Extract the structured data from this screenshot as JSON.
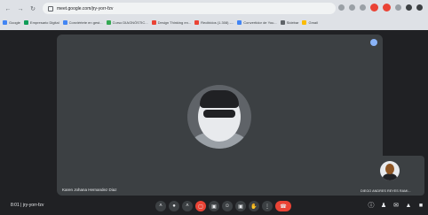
{
  "browser": {
    "url": "meet.google.com/jry-yorr-fzv",
    "bookmarks": [
      {
        "label": "Google",
        "color": "#4285f4"
      },
      {
        "label": "Empresario Digital",
        "color": "#0f9d58"
      },
      {
        "label": "Conviértete en gest...",
        "color": "#4285f4"
      },
      {
        "label": "Curso DIAGNÓSTIC...",
        "color": "#34a853"
      },
      {
        "label": "Design Thinking en...",
        "color": "#ea4335"
      },
      {
        "label": "Recibidos (1.308) -...",
        "color": "#ea4335"
      },
      {
        "label": "Convertidor de You...",
        "color": "#4285f4"
      },
      {
        "label": "Sidebar",
        "color": "#5f6368"
      },
      {
        "label": "Gmail",
        "color": "#fbbc05"
      }
    ]
  },
  "meeting": {
    "main_participant": "Karen Johana Hernandez Diaz",
    "self_participant": "DIEGO ANDRES REYES RAMI...",
    "time": "8:01",
    "meeting_code": "jry-yorr-fzv"
  },
  "colors": {
    "accent": "#8ab4f8",
    "danger": "#ea4335",
    "stage": "#3c4043",
    "bg": "#202124"
  },
  "icons": {
    "controls": [
      "chevron-up-icon",
      "mic-icon",
      "chevron-up-icon",
      "camera-off-icon",
      "captions-icon",
      "emoji-icon",
      "present-icon",
      "hand-icon",
      "more-icon",
      "hangup-icon"
    ],
    "side": [
      "info-icon",
      "people-icon",
      "chat-icon",
      "activities-icon",
      "lock-icon"
    ]
  }
}
